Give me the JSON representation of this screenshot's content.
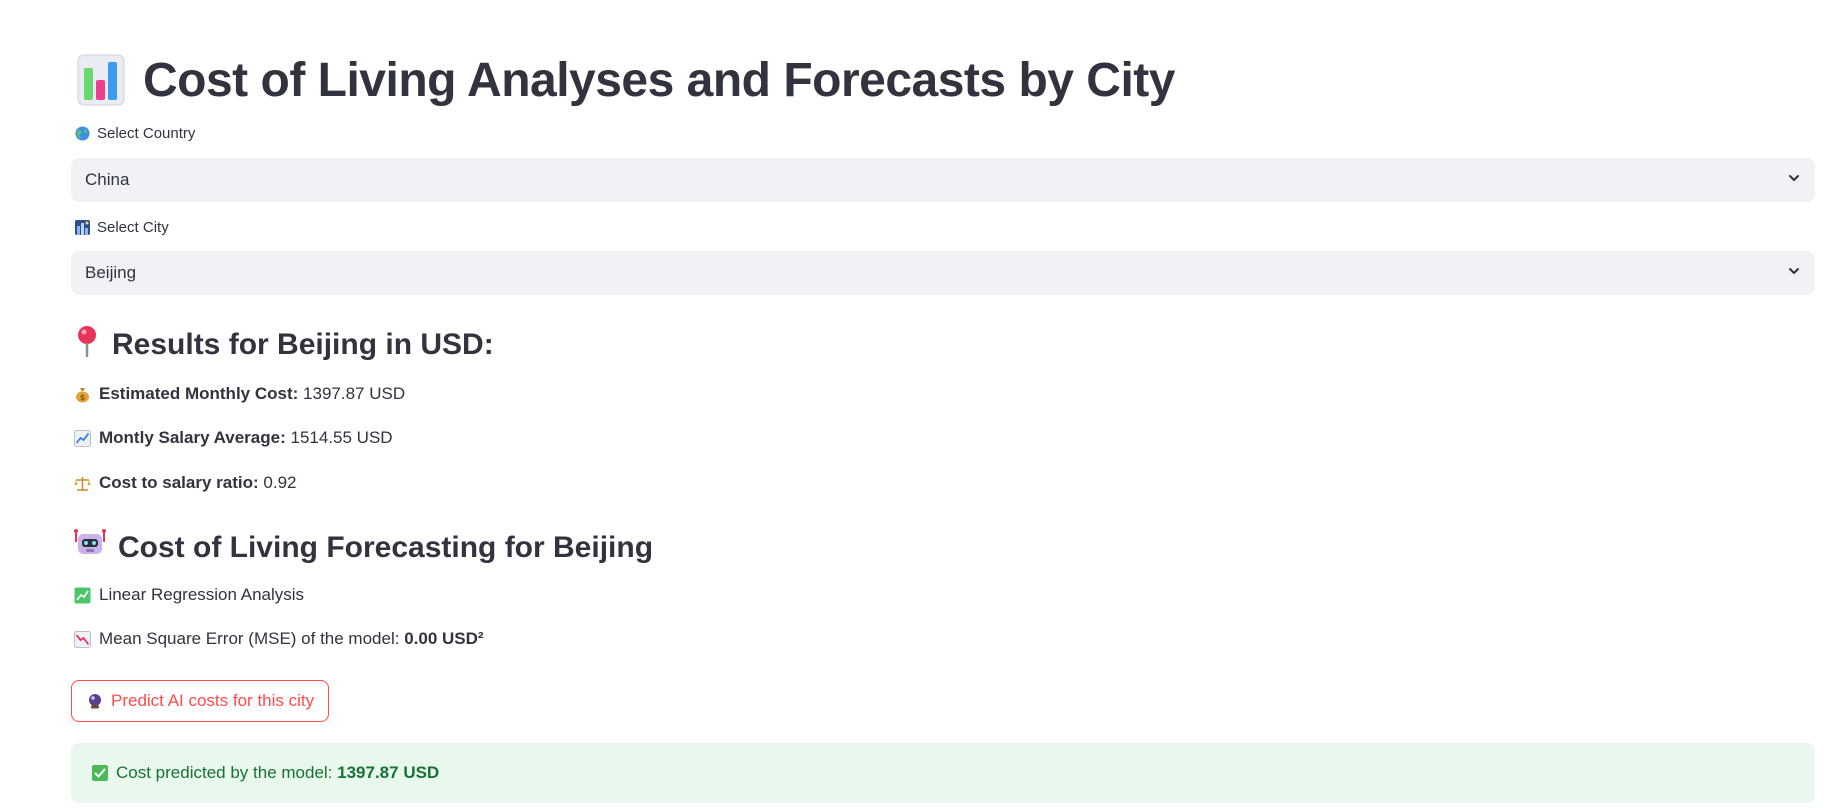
{
  "header": {
    "title": "Cost of Living Analyses and Forecasts by City",
    "title_icon": "bar-chart-emoji"
  },
  "country_select": {
    "label": "Select Country",
    "label_icon": "globe-emoji",
    "value": "China"
  },
  "city_select": {
    "label": "Select City",
    "label_icon": "cityscape-emoji",
    "value": "Beijing"
  },
  "results": {
    "heading": "Results for Beijing in USD:",
    "heading_icon": "pushpin-emoji",
    "monthly_cost_label": "Estimated Monthly Cost:",
    "monthly_cost_value": "1397.87 USD",
    "monthly_cost_icon": "money-bag-emoji",
    "salary_label": "Montly Salary Average:",
    "salary_value": "1514.55 USD",
    "salary_icon": "chart-increasing-emoji",
    "ratio_label": "Cost to salary ratio:",
    "ratio_value": "0.92",
    "ratio_icon": "balance-scale-emoji"
  },
  "forecast": {
    "heading": "Cost of Living Forecasting for Beijing",
    "heading_icon": "robot-emoji",
    "method_text": "Linear Regression Analysis",
    "method_icon": "chart-exchange-emoji",
    "mse_label": "Mean Square Error (MSE) of the model:",
    "mse_value": "0.00 USD²",
    "mse_icon": "chart-decreasing-emoji"
  },
  "predict_button": {
    "label": "Predict AI costs for this city",
    "icon": "crystal-ball-emoji"
  },
  "prediction": {
    "label": "Cost predicted by the model:",
    "value": "1397.87 USD",
    "icon": "check-mark-emoji"
  },
  "colors": {
    "accent": "#ff4b4b",
    "select_bg": "#f0f2f6",
    "success_bg": "#e8f8ec",
    "success_text": "#177233",
    "text": "#31333f"
  }
}
